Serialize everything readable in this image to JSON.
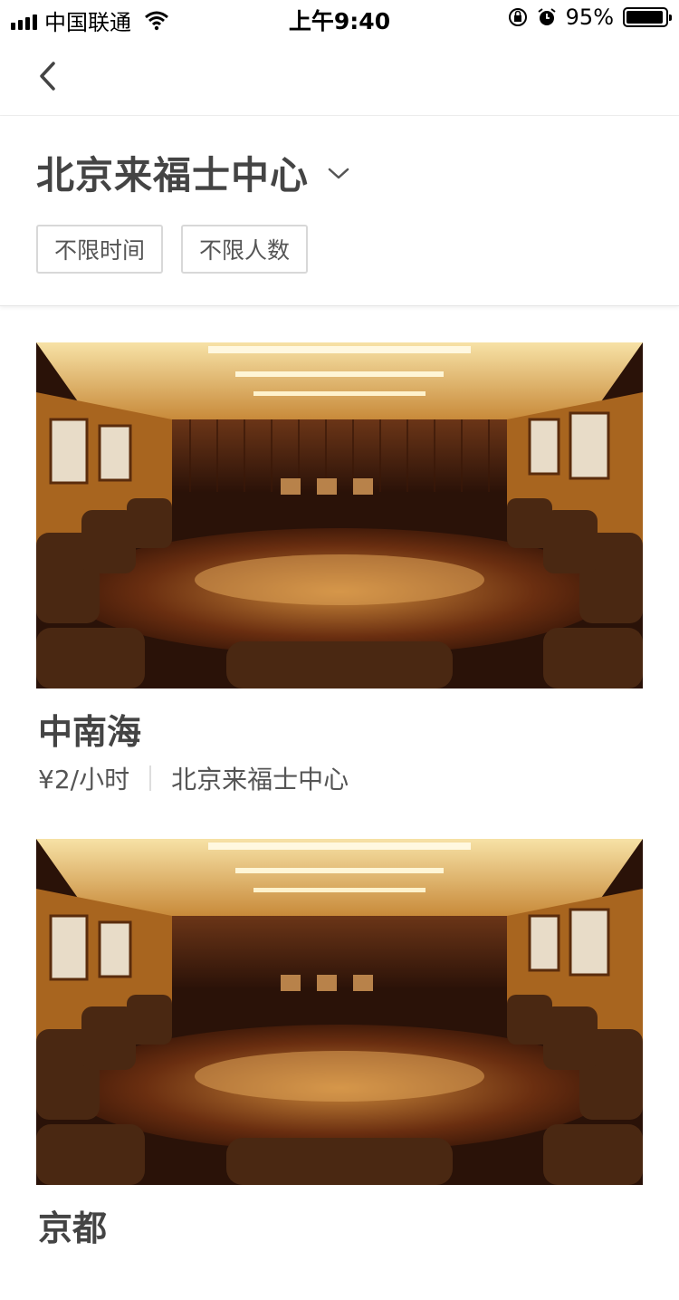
{
  "status_bar": {
    "carrier": "中国联通",
    "time": "上午9:40",
    "battery_percent": "95%",
    "battery_level": 0.95
  },
  "nav": {
    "back_icon": "chevron-left-icon"
  },
  "filter": {
    "location": "北京来福士中心",
    "chips": [
      "不限时间",
      "不限人数"
    ]
  },
  "rooms": [
    {
      "name": "中南海",
      "price": "¥2/小时",
      "location": "北京来福士中心",
      "image": "conference-room-photo"
    },
    {
      "name": "京都",
      "price": "",
      "location": "",
      "image": "conference-room-photo"
    }
  ]
}
